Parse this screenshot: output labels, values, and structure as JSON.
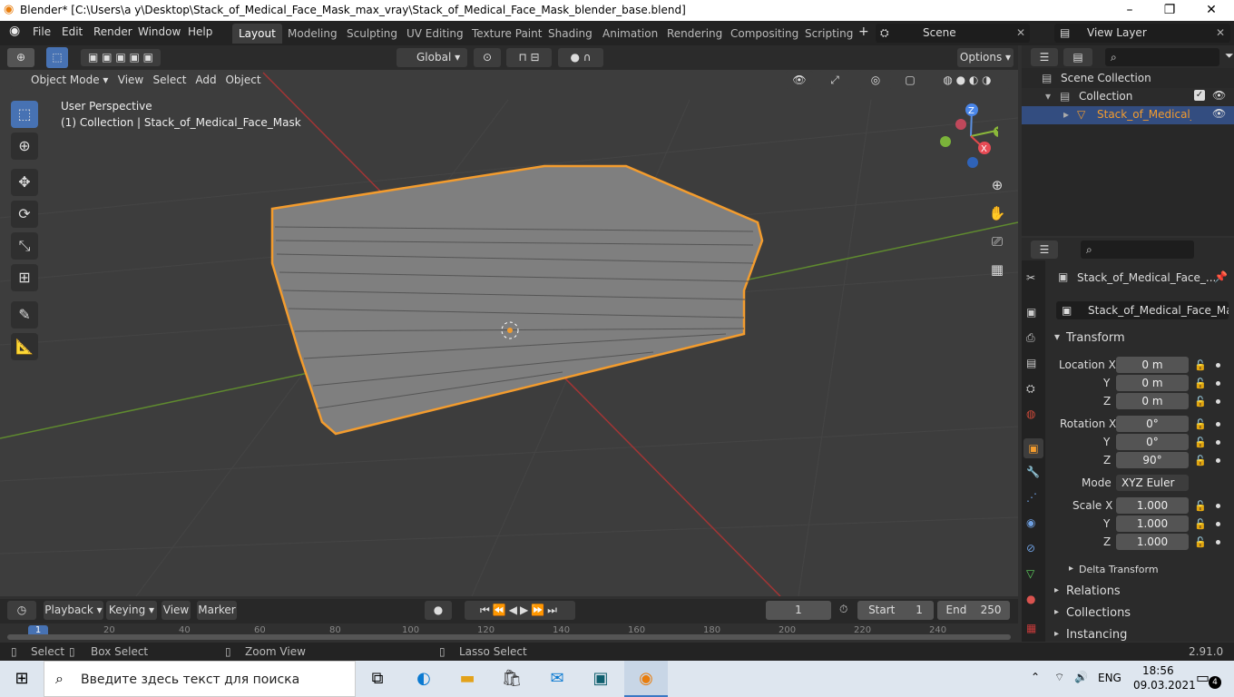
{
  "titlebar": {
    "title": "Blender* [C:\\Users\\a y\\Desktop\\Stack_of_Medical_Face_Mask_max_vray\\Stack_of_Medical_Face_Mask_blender_base.blend]",
    "minimize": "–",
    "maximize": "❐",
    "close": "✕"
  },
  "menu": [
    "File",
    "Edit",
    "Render",
    "Window",
    "Help"
  ],
  "workspaces": [
    "Layout",
    "Modeling",
    "Sculpting",
    "UV Editing",
    "Texture Paint",
    "Shading",
    "Animation",
    "Rendering",
    "Compositing",
    "Scripting"
  ],
  "scene": {
    "name": "Scene",
    "view_layer": "View Layer"
  },
  "toolheader": {
    "orientation": "Global",
    "options": "Options"
  },
  "viewport_header": {
    "mode": "Object Mode",
    "menus": [
      "View",
      "Select",
      "Add",
      "Object"
    ]
  },
  "viewport": {
    "perspective": "User Perspective",
    "collection": "(1) Collection | Stack_of_Medical_Face_Mask",
    "gizmo": {
      "z": "Z",
      "y": "Y",
      "x": "X"
    }
  },
  "outliner": {
    "scene_collection": "Scene Collection",
    "collection": "Collection",
    "object": "Stack_of_Medical_Fa"
  },
  "props": {
    "object_name": "Stack_of_Medical_Face_...",
    "data_name": "Stack_of_Medical_Face_Mask",
    "transform": "Transform",
    "location_label": "Location X",
    "loc": [
      "0 m",
      "0 m",
      "0 m"
    ],
    "rotation_label": "Rotation X",
    "rot": [
      "0°",
      "0°",
      "90°"
    ],
    "mode_label": "Mode",
    "mode": "XYZ Euler",
    "scale_label": "Scale X",
    "scale": [
      "1.000",
      "1.000",
      "1.000"
    ],
    "y": "Y",
    "z": "Z",
    "delta": "Delta Transform",
    "sections": [
      "Relations",
      "Collections",
      "Instancing"
    ]
  },
  "timeline": {
    "menus": [
      "Playback",
      "Keying",
      "View",
      "Marker"
    ],
    "current": "1",
    "start_label": "Start",
    "start": "1",
    "end_label": "End",
    "end": "250",
    "ticks": [
      "1",
      "20",
      "40",
      "60",
      "80",
      "100",
      "120",
      "140",
      "160",
      "180",
      "200",
      "220",
      "240"
    ]
  },
  "status": {
    "select": "Select",
    "box": "Box Select",
    "zoom": "Zoom View",
    "lasso": "Lasso Select",
    "version": "2.91.0"
  },
  "taskbar": {
    "search": "Введите здесь текст для поиска",
    "lang": "ENG",
    "time": "18:56",
    "date": "09.03.2021",
    "notif": "4"
  }
}
